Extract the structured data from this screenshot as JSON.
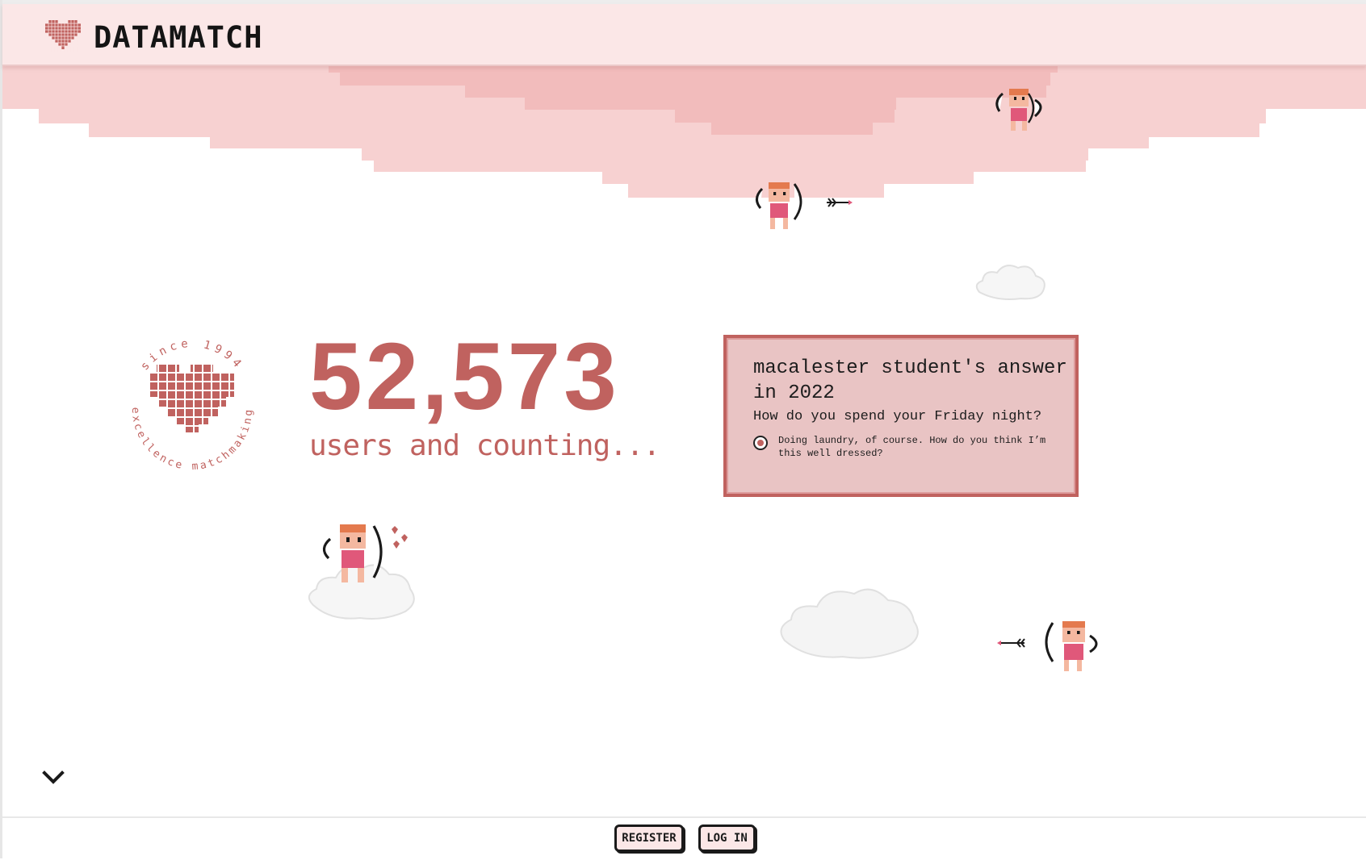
{
  "header": {
    "brand": "DATAMATCH"
  },
  "badge": {
    "top_text": "since 1994",
    "bottom_text": "excellence matchmaking",
    "icon": "heart-icon"
  },
  "stats": {
    "count": "52,573",
    "caption": "users and counting..."
  },
  "card": {
    "title": "macalester student's answer in 2022",
    "question": "How do you spend your Friday night?",
    "answer": "Doing laundry, of course. How do you think I’m this well dressed?"
  },
  "footer": {
    "register_label": "REGISTER",
    "login_label": "LOG IN"
  },
  "colors": {
    "accent": "#c0625f",
    "header_bg": "#fbe7e7",
    "card_bg": "#e9c4c4"
  },
  "icons": [
    "heart-icon",
    "chevron-down-icon",
    "cupid-icon",
    "cloud-icon",
    "arrow-icon"
  ]
}
